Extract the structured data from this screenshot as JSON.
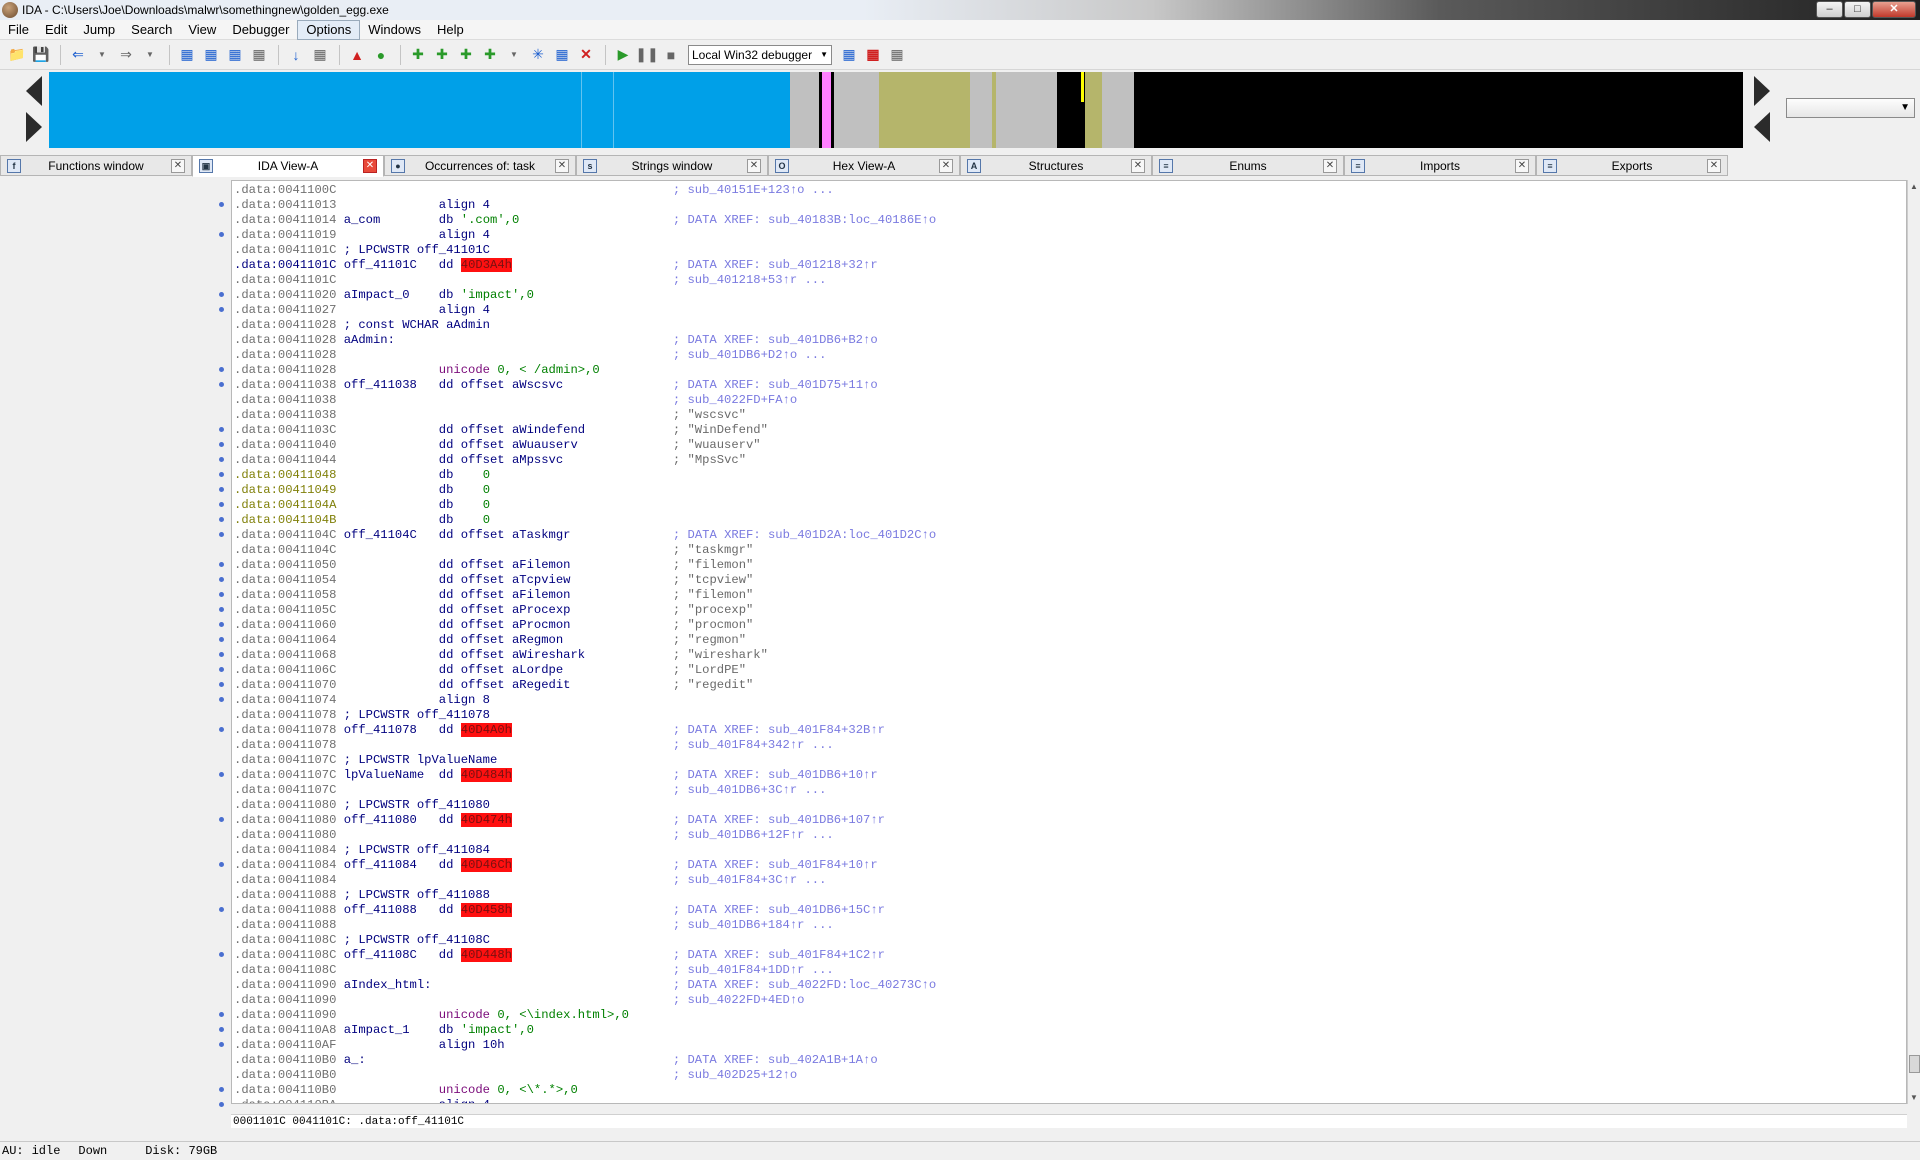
{
  "window": {
    "title": "IDA - C:\\Users\\Joe\\Downloads\\malwr\\somethingnew\\golden_egg.exe"
  },
  "menu": [
    "File",
    "Edit",
    "Jump",
    "Search",
    "View",
    "Debugger",
    "Options",
    "Windows",
    "Help"
  ],
  "toolbar": {
    "debugger_select": "Local Win32 debugger"
  },
  "tabs": [
    {
      "label": "Functions window",
      "icon": "f"
    },
    {
      "label": "IDA View-A",
      "icon": "▣"
    },
    {
      "label": "Occurrences of: task",
      "icon": "●"
    },
    {
      "label": "Strings window",
      "icon": "s"
    },
    {
      "label": "Hex View-A",
      "icon": "O"
    },
    {
      "label": "Structures",
      "icon": "A"
    },
    {
      "label": "Enums",
      "icon": "≡"
    },
    {
      "label": "Imports",
      "icon": "≡"
    },
    {
      "label": "Exports",
      "icon": "≡"
    }
  ],
  "colors": {
    "code_blue": "#00a0e8",
    "unexplored": "#c0c0c0",
    "data_olive": "#b5b56b",
    "pink": "#ff80ff",
    "yellow": "#ffff00",
    "black": "#000000"
  },
  "listing": [
    {
      "a": ".data:0041100C",
      "l": "",
      "m": "",
      "o": "",
      "c": "; sub_40151E+123↑o ..."
    },
    {
      "a": ".data:00411013",
      "l": "",
      "m": "align 4",
      "o": "",
      "c": ""
    },
    {
      "a": ".data:00411014",
      "l": "a_com",
      "m": "db",
      "o": "'.com',0",
      "c": "; DATA XREF: sub_40183B:loc_40186E↑o"
    },
    {
      "a": ".data:00411019",
      "l": "",
      "m": "align 4",
      "o": "",
      "c": ""
    },
    {
      "a": ".data:0041101C",
      "l": "; LPCWSTR off_41101C",
      "m": "",
      "o": "",
      "c": ""
    },
    {
      "a": ".data:0041101C",
      "l": "off_41101C",
      "m": "dd",
      "o": "40D3A4h",
      "hl": true,
      "c": "; DATA XREF: sub_401218+32↑r",
      "sel": true
    },
    {
      "a": ".data:0041101C",
      "l": "",
      "m": "",
      "o": "",
      "c": "; sub_401218+53↑r ..."
    },
    {
      "a": ".data:00411020",
      "l": "aImpact_0",
      "m": "db",
      "o": "'impact',0",
      "c": ""
    },
    {
      "a": ".data:00411027",
      "l": "",
      "m": "align 4",
      "o": "",
      "c": ""
    },
    {
      "a": ".data:00411028",
      "l": "; const WCHAR aAdmin",
      "m": "",
      "o": "",
      "c": ""
    },
    {
      "a": ".data:00411028",
      "l": "aAdmin:",
      "m": "",
      "o": "",
      "c": "; DATA XREF: sub_401DB6+B2↑o"
    },
    {
      "a": ".data:00411028",
      "l": "",
      "m": "",
      "o": "",
      "c": "; sub_401DB6+D2↑o ..."
    },
    {
      "a": ".data:00411028",
      "l": "",
      "m": "unicode",
      "o": "0, < /admin>,0",
      "u": true,
      "c": ""
    },
    {
      "a": ".data:00411038",
      "l": "off_411038",
      "m": "dd offset",
      "o": "aWscsvc",
      "c": "; DATA XREF: sub_401D75+11↑o"
    },
    {
      "a": ".data:00411038",
      "l": "",
      "m": "",
      "o": "",
      "c": "; sub_4022FD+FA↑o"
    },
    {
      "a": ".data:00411038",
      "l": "",
      "m": "",
      "o": "",
      "c": "; \"wscsvc\""
    },
    {
      "a": ".data:0041103C",
      "l": "",
      "m": "dd offset",
      "o": "aWindefend",
      "c": "; \"WinDefend\""
    },
    {
      "a": ".data:00411040",
      "l": "",
      "m": "dd offset",
      "o": "aWuauserv",
      "c": "; \"wuauserv\""
    },
    {
      "a": ".data:00411044",
      "l": "",
      "m": "dd offset",
      "o": "aMpssvc",
      "c": "; \"MpsSvc\""
    },
    {
      "a": ".data:00411048",
      "l": "",
      "m": "db",
      "o": "   0",
      "olive": true,
      "c": ""
    },
    {
      "a": ".data:00411049",
      "l": "",
      "m": "db",
      "o": "   0",
      "olive": true,
      "c": ""
    },
    {
      "a": ".data:0041104A",
      "l": "",
      "m": "db",
      "o": "   0",
      "olive": true,
      "c": ""
    },
    {
      "a": ".data:0041104B",
      "l": "",
      "m": "db",
      "o": "   0",
      "olive": true,
      "c": ""
    },
    {
      "a": ".data:0041104C",
      "l": "off_41104C",
      "m": "dd offset",
      "o": "aTaskmgr",
      "c": "; DATA XREF: sub_401D2A:loc_401D2C↑o"
    },
    {
      "a": ".data:0041104C",
      "l": "",
      "m": "",
      "o": "",
      "c": "; \"taskmgr\""
    },
    {
      "a": ".data:00411050",
      "l": "",
      "m": "dd offset",
      "o": "aFilemon",
      "c": "; \"filemon\""
    },
    {
      "a": ".data:00411054",
      "l": "",
      "m": "dd offset",
      "o": "aTcpview",
      "c": "; \"tcpview\""
    },
    {
      "a": ".data:00411058",
      "l": "",
      "m": "dd offset",
      "o": "aFilemon",
      "c": "; \"filemon\""
    },
    {
      "a": ".data:0041105C",
      "l": "",
      "m": "dd offset",
      "o": "aProcexp",
      "c": "; \"procexp\""
    },
    {
      "a": ".data:00411060",
      "l": "",
      "m": "dd offset",
      "o": "aProcmon",
      "c": "; \"procmon\""
    },
    {
      "a": ".data:00411064",
      "l": "",
      "m": "dd offset",
      "o": "aRegmon",
      "c": "; \"regmon\""
    },
    {
      "a": ".data:00411068",
      "l": "",
      "m": "dd offset",
      "o": "aWireshark",
      "c": "; \"wireshark\""
    },
    {
      "a": ".data:0041106C",
      "l": "",
      "m": "dd offset",
      "o": "aLordpe",
      "c": "; \"LordPE\""
    },
    {
      "a": ".data:00411070",
      "l": "",
      "m": "dd offset",
      "o": "aRegedit",
      "c": "; \"regedit\""
    },
    {
      "a": ".data:00411074",
      "l": "",
      "m": "align 8",
      "o": "",
      "c": ""
    },
    {
      "a": ".data:00411078",
      "l": "; LPCWSTR off_411078",
      "m": "",
      "o": "",
      "c": ""
    },
    {
      "a": ".data:00411078",
      "l": "off_411078",
      "m": "dd",
      "o": "40D4A0h",
      "hl": true,
      "c": "; DATA XREF: sub_401F84+32B↑r"
    },
    {
      "a": ".data:00411078",
      "l": "",
      "m": "",
      "o": "",
      "c": "; sub_401F84+342↑r ..."
    },
    {
      "a": ".data:0041107C",
      "l": "; LPCWSTR lpValueName",
      "m": "",
      "o": "",
      "c": ""
    },
    {
      "a": ".data:0041107C",
      "l": "lpValueName",
      "m": "dd",
      "o": "40D484h",
      "hl": true,
      "c": "; DATA XREF: sub_401DB6+10↑r"
    },
    {
      "a": ".data:0041107C",
      "l": "",
      "m": "",
      "o": "",
      "c": "; sub_401DB6+3C↑r ..."
    },
    {
      "a": ".data:00411080",
      "l": "; LPCWSTR off_411080",
      "m": "",
      "o": "",
      "c": ""
    },
    {
      "a": ".data:00411080",
      "l": "off_411080",
      "m": "dd",
      "o": "40D474h",
      "hl": true,
      "c": "; DATA XREF: sub_401DB6+107↑r"
    },
    {
      "a": ".data:00411080",
      "l": "",
      "m": "",
      "o": "",
      "c": "; sub_401DB6+12F↑r ..."
    },
    {
      "a": ".data:00411084",
      "l": "; LPCWSTR off_411084",
      "m": "",
      "o": "",
      "c": ""
    },
    {
      "a": ".data:00411084",
      "l": "off_411084",
      "m": "dd",
      "o": "40D46Ch",
      "hl": true,
      "c": "; DATA XREF: sub_401F84+10↑r"
    },
    {
      "a": ".data:00411084",
      "l": "",
      "m": "",
      "o": "",
      "c": "; sub_401F84+3C↑r ..."
    },
    {
      "a": ".data:00411088",
      "l": "; LPCWSTR off_411088",
      "m": "",
      "o": "",
      "c": ""
    },
    {
      "a": ".data:00411088",
      "l": "off_411088",
      "m": "dd",
      "o": "40D458h",
      "hl": true,
      "c": "; DATA XREF: sub_401DB6+15C↑r"
    },
    {
      "a": ".data:00411088",
      "l": "",
      "m": "",
      "o": "",
      "c": "; sub_401DB6+184↑r ..."
    },
    {
      "a": ".data:0041108C",
      "l": "; LPCWSTR off_41108C",
      "m": "",
      "o": "",
      "c": ""
    },
    {
      "a": ".data:0041108C",
      "l": "off_41108C",
      "m": "dd",
      "o": "40D448h",
      "hl": true,
      "c": "; DATA XREF: sub_401F84+1C2↑r"
    },
    {
      "a": ".data:0041108C",
      "l": "",
      "m": "",
      "o": "",
      "c": "; sub_401F84+1DD↑r ..."
    },
    {
      "a": ".data:00411090",
      "l": "aIndex_html:",
      "m": "",
      "o": "",
      "c": "; DATA XREF: sub_4022FD:loc_40273C↑o"
    },
    {
      "a": ".data:00411090",
      "l": "",
      "m": "",
      "o": "",
      "c": "; sub_4022FD+4ED↑o"
    },
    {
      "a": ".data:00411090",
      "l": "",
      "m": "unicode",
      "o": "0, <\\index.html>,0",
      "u": true,
      "c": ""
    },
    {
      "a": ".data:004110A8",
      "l": "aImpact_1",
      "m": "db",
      "o": "'impact',0",
      "c": ""
    },
    {
      "a": ".data:004110AF",
      "l": "",
      "m": "align 10h",
      "o": "",
      "c": ""
    },
    {
      "a": ".data:004110B0",
      "l": "a_:",
      "m": "",
      "o": "",
      "c": "; DATA XREF: sub_402A1B+1A↑o"
    },
    {
      "a": ".data:004110B0",
      "l": "",
      "m": "",
      "o": "",
      "c": "; sub_402D25+12↑o"
    },
    {
      "a": ".data:004110B0",
      "l": "",
      "m": "unicode",
      "o": "0, <\\*.*>,0",
      "u": true,
      "c": ""
    },
    {
      "a": ".data:004110BA",
      "l": "",
      "m": "align 4",
      "o": "",
      "c": ""
    }
  ],
  "dots": [
    1,
    3,
    7,
    8,
    12,
    13,
    16,
    17,
    18,
    19,
    20,
    21,
    22,
    23,
    25,
    26,
    27,
    28,
    29,
    30,
    31,
    32,
    33,
    34,
    36,
    39,
    42,
    45,
    48,
    51,
    55,
    56,
    57,
    60,
    61
  ],
  "status_line": "0001101C 0041101C: .data:off_41101C",
  "statusbar": {
    "au": "AU:",
    "state": "idle",
    "dir": "Down",
    "disk": "Disk: 79GB"
  }
}
